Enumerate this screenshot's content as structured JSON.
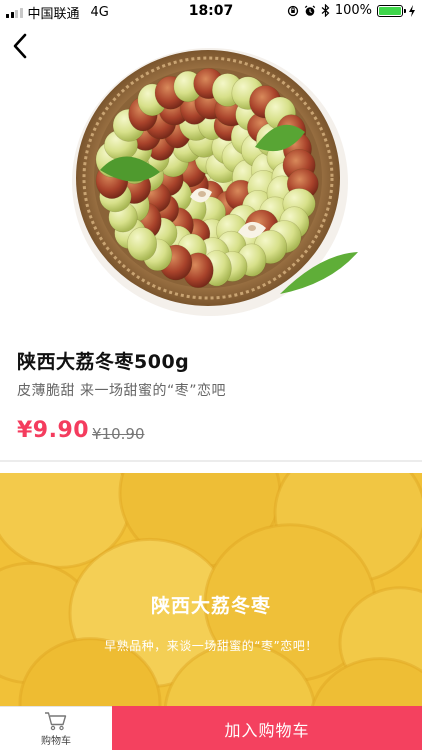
{
  "status_bar": {
    "carrier": "中国联通",
    "network": "4G",
    "time": "18:07",
    "battery": "100%",
    "battery_color": "#3fd64b"
  },
  "nav": {
    "back_icon": "chevron-left-icon"
  },
  "product": {
    "image": "jujube-basket-photo",
    "title": "陕西大荔冬枣500g",
    "subtitle": "皮薄脆甜  来一场甜蜜的“枣”恋吧",
    "price": "¥9.90",
    "old_price": "¥10.90",
    "price_color": "#f43c5e"
  },
  "detail_banner": {
    "title": "陕西大荔冬枣",
    "text": "早熟品种，来谈一场甜蜜的“枣”恋吧！",
    "background_color": "#f4c63e"
  },
  "bottom_bar": {
    "cart_icon": "shopping-cart-icon",
    "cart_label": "购物车",
    "add_to_cart_label": "加入购物车",
    "accent_color": "#f4415f"
  }
}
